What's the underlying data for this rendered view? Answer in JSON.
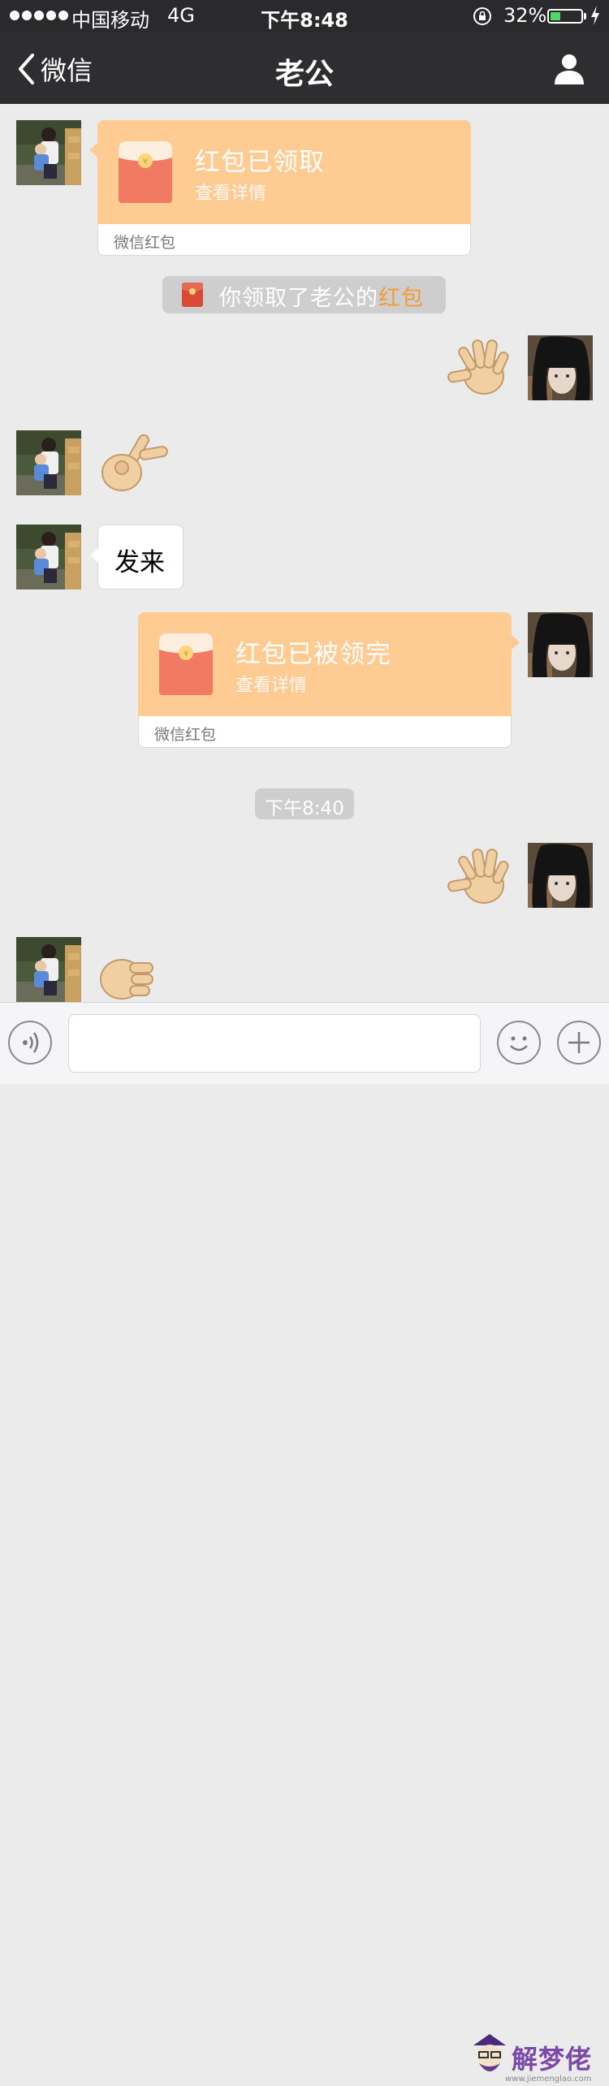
{
  "status_bar": {
    "carrier": "中国移动",
    "network": "4G",
    "time": "下午8:48",
    "battery_percent": "32%",
    "battery_level": 0.32,
    "battery_color": "#4cd964"
  },
  "nav": {
    "back_label": "微信",
    "title": "老公",
    "back_icon": "chevron-left-icon",
    "profile_icon": "person-icon"
  },
  "messages": {
    "red_packet_1": {
      "title": "红包已领取",
      "subtitle": "查看详情",
      "footer": "微信红包"
    },
    "system_notice": {
      "prefix": "你领取了老公的",
      "highlight": "红包",
      "highlight_color": "#f59a37"
    },
    "text_message": "发来",
    "red_packet_2": {
      "title": "红包已被领完",
      "subtitle": "查看详情",
      "footer": "微信红包"
    },
    "timestamp": "下午8:40",
    "stickers": [
      "palm-hand-sticker",
      "victory-hand-sticker",
      "palm-hand-sticker",
      "fist-hand-sticker"
    ]
  },
  "input_bar": {
    "voice_icon": "voice-icon",
    "emoji_icon": "emoji-icon",
    "plus_icon": "plus-icon"
  },
  "watermark": {
    "text": "解梦佬",
    "url": "www.jiemenglao.com"
  },
  "colors": {
    "red_packet": "#fecb93",
    "background": "#ebebeb",
    "nav": "#2e2e30"
  }
}
